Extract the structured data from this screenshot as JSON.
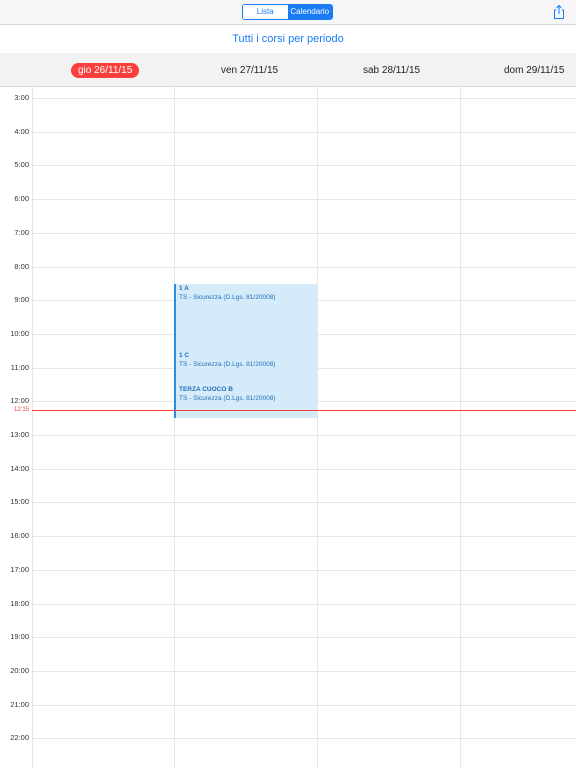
{
  "toolbar": {
    "segments": [
      "Lista",
      "Calendario"
    ],
    "active_segment": "Calendario",
    "share_icon": "share-icon"
  },
  "subtitle": "Tutti i corsi per periodo",
  "days": [
    {
      "label": "gio 26/11/15",
      "today": true
    },
    {
      "label": "ven 27/11/15",
      "today": false
    },
    {
      "label": "sab 28/11/15",
      "today": false
    },
    {
      "label": "dom 29/11/15",
      "today": false
    }
  ],
  "hours": [
    "3:00",
    "4:00",
    "5:00",
    "6:00",
    "7:00",
    "8:00",
    "9:00",
    "10:00",
    "11:00",
    "12:00",
    "13:00",
    "14:00",
    "15:00",
    "16:00",
    "17:00",
    "18:00",
    "19:00",
    "20:00",
    "21:00",
    "22:00"
  ],
  "current_time": "12:15",
  "events": [
    {
      "title": "1 A",
      "subtitle": "TS - Sicurezza (D.Lgs. 81/20008)"
    },
    {
      "title": "1 C",
      "subtitle": "TS - Sicurezza (D.Lgs. 81/20008)"
    },
    {
      "title": "TERZA CUOCO B",
      "subtitle": "TS - Sicurezza (D.Lgs. 81/20008)"
    }
  ],
  "colors": {
    "accent": "#1a7cf5",
    "today": "#f9403c",
    "event_bg": "#d5ebfa",
    "event_text": "#1e6fb8"
  }
}
